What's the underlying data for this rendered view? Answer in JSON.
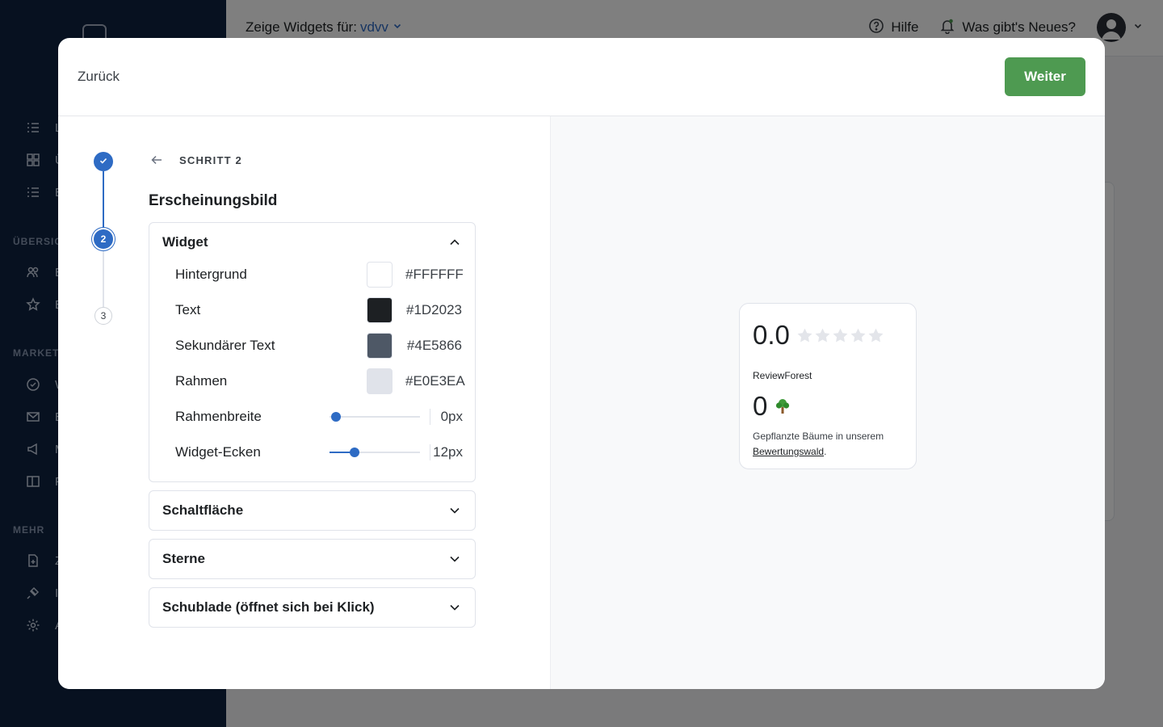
{
  "background": {
    "topbar": {
      "widgets_for_label": "Zeige Widgets für:",
      "account": "vdvv",
      "help": "Hilfe",
      "whats_new": "Was gibt's Neues?"
    },
    "sidebar": {
      "section_1": "ÜBERSIC",
      "section_2": "MARKET",
      "section_3": "MEHR",
      "items": [
        "L",
        "Ü",
        "E",
        "E",
        "E",
        "W",
        "E",
        "M",
        "P",
        "Z",
        "I",
        "A"
      ]
    }
  },
  "modal": {
    "back_label": "Zurück",
    "next_label": "Weiter",
    "stepper": {
      "step_1": "✓",
      "step_2": "2",
      "step_3": "3"
    },
    "step_label": "SCHRITT 2",
    "section_title": "Erscheinungsbild",
    "widget_section": {
      "title": "Widget",
      "colors": [
        {
          "label": "Hintergrund",
          "hex": "#FFFFFF",
          "swatch": "#FFFFFF"
        },
        {
          "label": "Text",
          "hex": "#1D2023",
          "swatch": "#1D2023"
        },
        {
          "label": "Sekundärer Text",
          "hex": "#4E5866",
          "swatch": "#4E5866"
        },
        {
          "label": "Rahmen",
          "hex": "#E0E3EA",
          "swatch": "#E0E3EA"
        }
      ],
      "border_width": {
        "label": "Rahmenbreite",
        "value_text": "0px",
        "value": 0
      },
      "corners": {
        "label": "Widget-Ecken",
        "value_text": "12px",
        "value": 0.28
      }
    },
    "collapsed_sections": [
      "Schaltfläche",
      "Sterne",
      "Schublade (öffnet sich bei Klick)"
    ]
  },
  "preview": {
    "score": "0.0",
    "stars_filled": 0,
    "stars_total": 5,
    "brand": "ReviewForest",
    "trees_count": "0",
    "tree_icon": "tree-icon",
    "desc_prefix": "Gepflanzte Bäume in unserem ",
    "desc_link": "Bewertungswald",
    "desc_suffix": "."
  },
  "colors": {
    "primary": "#2e6bc4",
    "success": "#4e9a51",
    "sidebar": "#0f2241"
  }
}
